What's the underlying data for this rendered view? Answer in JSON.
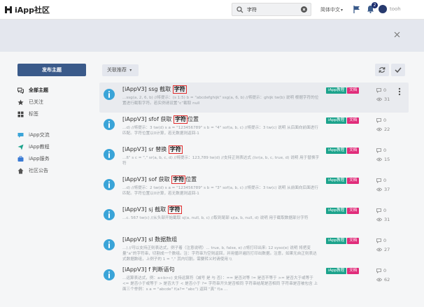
{
  "header": {
    "logo_text": "iApp社区",
    "search_value": "字符",
    "language": "简体中文",
    "notification_count": "2",
    "username": "tooh"
  },
  "sidebar": {
    "post_button": "发布主题",
    "group1": [
      {
        "label": "全部主题",
        "icon": "comments-icon",
        "active": true
      },
      {
        "label": "已关注",
        "icon": "star-icon",
        "active": false
      },
      {
        "label": "标签",
        "icon": "tags-icon",
        "active": false
      }
    ],
    "group2": [
      {
        "label": "iApp交流",
        "icon": "chat-icon"
      },
      {
        "label": "iApp教程",
        "icon": "send-icon"
      },
      {
        "label": "iApp服务",
        "icon": "service-icon"
      },
      {
        "label": "社区公告",
        "icon": "home-icon"
      }
    ]
  },
  "toolbar": {
    "sort_label": "关联推荐"
  },
  "tags": {
    "tag1": "iApp教程",
    "tag2": "文档"
  },
  "discussions": [
    {
      "title_prefix": "[iAppV3] ssg 截取",
      "keyword": "字符",
      "title_suffix": "",
      "desc": "...ssg(a, 2, 6, b) //将提示：(s 1:5) b = \"abcdefghijk\" ssg(a, 6, b) //将提示：ghijk tw(b) 说明 根据字符的位置进行截取字符。若实例请设置“c”截取 null",
      "replies": "0",
      "views": "31"
    },
    {
      "title_prefix": "[iAppV3] sfof 获取",
      "keyword": "字符",
      "title_suffix": "位置",
      "desc": "...d) //将提示：3 tw(d) s a = \"123456789\" s b = \"4\" sof(a, b, c) //将提示：3 tw(c) 说明 从后面向前面进行匹配。字符位置以0计算，若无数据则返回-1",
      "replies": "0",
      "views": "22"
    },
    {
      "title_prefix": "[iAppV3] sr 替换",
      "keyword": "字符",
      "title_suffix": "",
      "desc": "...ß\" s c = \",\" sr(a, b, c, d) //将提示：123,789 tw(d) //支持正则表达式 //sr(a, b, c, true, d) 说明 用于替换字符",
      "replies": "0",
      "views": "15"
    },
    {
      "title_prefix": "[iAppV3] sof 获取",
      "keyword": "字符",
      "title_suffix": "位置",
      "desc": "...d) //将提示：2 tw(d) s a = \"123456789\" s b = \"3\" sof(a, b, c) //将提示：3 tw(c) 说明 从前面向后面进行匹配。字符位置以0计算，若无数据则返回-1",
      "replies": "0",
      "views": "37"
    },
    {
      "title_prefix": "[iAppV3] sj 截取",
      "keyword": "字符",
      "title_suffix": "",
      "desc": "...c. 567 tw(c) //从头部开始截取 sj(a, null, b, c) //取到尾部 sj(a, b, null, d) 说明 用于截取数据部分字符",
      "replies": "0",
      "views": "31"
    },
    {
      "title_prefix": "[iAppV3] sl 数据数组",
      "keyword": "",
      "title_suffix": "",
      "desc": "...) //可以支持正则表达式，例子着（注意说明）... true, b, false, e) //将打印出来: 12 syso(e) 说明 将把变量“a”的字符串，切割成一个数组。注：字符串为空则返回，并用循环遍历打印出数据。注意，如果无自正则表达式数据数组，上例子的 1 = \",\" 其内切割。需要转义时请使用 \\\\",
      "replies": "0",
      "views": "27"
    },
    {
      "title_prefix": "[iAppV3] f 判断语句",
      "keyword": "",
      "title_suffix": "",
      "desc": "...运算表达式，例：a+b>c) 支持运算符（减号 是 与 否）：== 是否对等 != 是否不等于 >= 是否大于或等于 <= 是否小于或等于 > 是否大于 < 是否小于 ?= 字符串开头是否相同 字符串结尾是否相同 字符串是否被包含 上面三个举例：s a = \"abcde\" f(a?= \"abc\") 返回 \"真\" f(a ...",
      "replies": "0",
      "views": "62"
    }
  ]
}
